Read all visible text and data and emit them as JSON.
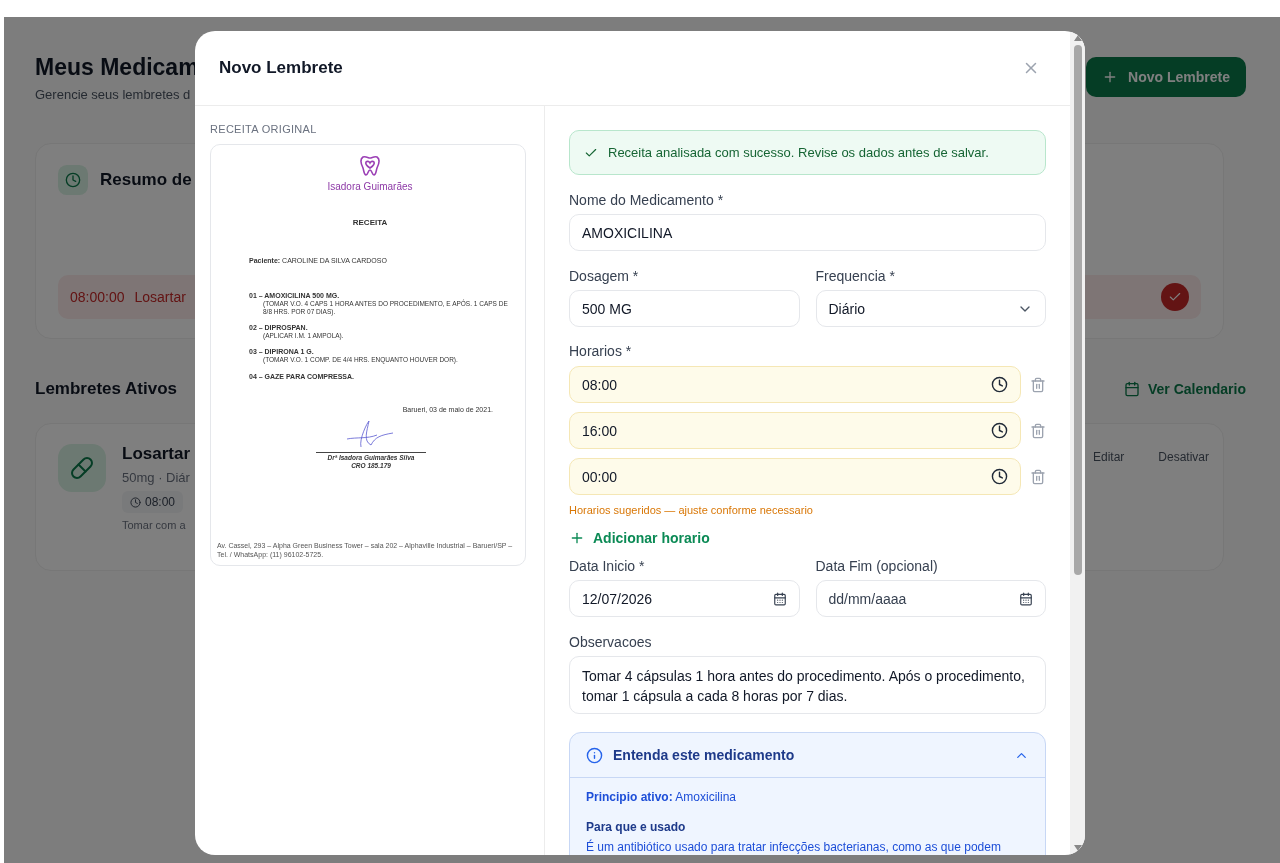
{
  "page": {
    "title": "Meus Medicam",
    "subtitle": "Gerencie seus lembretes d",
    "new_button": "Novo Lembrete"
  },
  "summary": {
    "title": "Resumo de",
    "alert": {
      "time": "08:00:00",
      "name": "Losartar"
    }
  },
  "active": {
    "title": "Lembretes Ativos",
    "calendar_link": "Ver Calendario",
    "items": [
      {
        "name": "Losartar",
        "detail": "50mg · Diár",
        "times": [
          "08:00"
        ],
        "note": "Tomar com a",
        "actions": [
          "Editar",
          "Desativar"
        ]
      }
    ]
  },
  "modal": {
    "title": "Novo Lembrete",
    "prescription": {
      "label": "RECEITA ORIGINAL",
      "clinic": "Isadora Guimarães",
      "heading": "RECEITA",
      "patient": "**Paciente:** CAROLINE DA SILVA CARDOSO",
      "items": [
        {
          "name": "01 – AMOXICILINA 500 MG.",
          "instructions": "(TOMAR V.O. 4 CAPS 1 HORA ANTES DO PROCEDIMENTO, E APÓS. 1 CAPS DE 8/8 HRS. POR 07 DIAS)."
        },
        {
          "name": "02 – DIPROSPAN.",
          "instructions": "(APLICAR I.M. 1 AMPOLA)."
        },
        {
          "name": "03 – DIPIRONA 1 G.",
          "instructions": "(TOMAR V.O. 1 COMP. DE 4/4 HRS. ENQUANTO HOUVER DOR)."
        },
        {
          "name": "04 – GAZE PARA COMPRESSA."
        }
      ],
      "place_date": "Barueri, 03 de maio de 2021.",
      "signature": [
        "Drª Isadora Guimarães Silva",
        "CRO 185.179"
      ],
      "footer": "Av. Cassel, 293 – Alpha Green Business Tower – sala 202 – Alphaville Industrial – Barueri/SP – Tel. / WhatsApp: (11) 96102-5725."
    },
    "form": {
      "success": "Receita analisada com sucesso. Revise os dados antes de salvar.",
      "name": {
        "label": "Nome do Medicamento *",
        "value": "AMOXICILINA"
      },
      "dosage": {
        "label": "Dosagem *",
        "value": "500 MG"
      },
      "frequency": {
        "label": "Frequencia *",
        "value": "Diário"
      },
      "schedules": {
        "label": "Horarios *",
        "times": [
          "08:00",
          "16:00",
          "00:00"
        ],
        "hint": "Horarios sugeridos — ajuste conforme necessario",
        "add": "Adicionar horario"
      },
      "start_date": {
        "label": "Data Inicio *",
        "value": "12/07/2026"
      },
      "end_date": {
        "label": "Data Fim (opcional)",
        "placeholder": "dd/mm/aaaa"
      },
      "notes": {
        "label": "Observacoes",
        "value": "Tomar 4 cápsulas 1 hora antes do procedimento. Após o procedimento, tomar 1 cápsula a cada 8 horas por 7 dias."
      },
      "info": {
        "title": "Entenda este medicamento",
        "expanded": true,
        "active_ingredient": "**Principio ativo:** Amoxicilina",
        "section_title": "Para que e usado",
        "section_text": "É um antibiótico usado para tratar infecções bacterianas, como as que podem"
      }
    }
  }
}
